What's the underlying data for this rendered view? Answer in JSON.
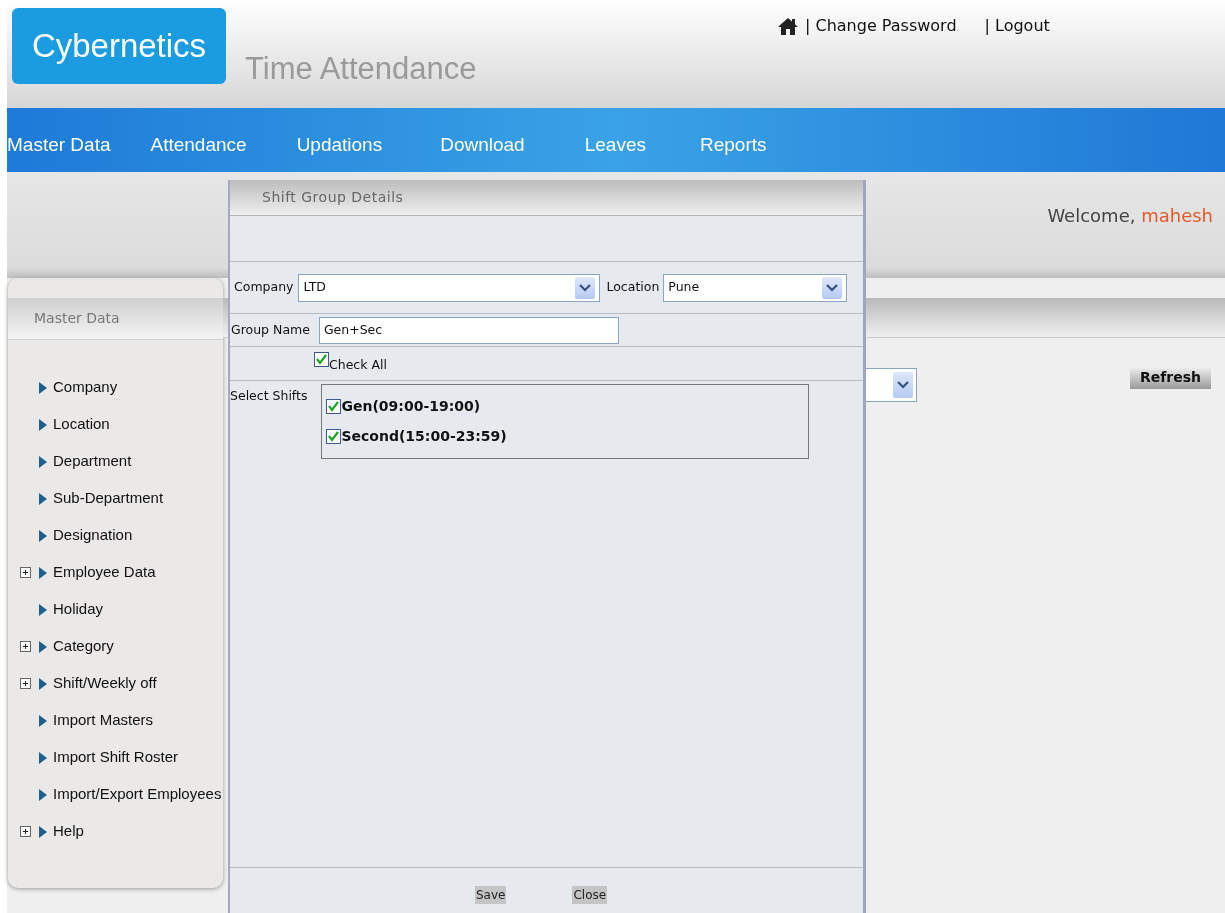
{
  "header": {
    "logo": "Cybernetics",
    "app_title": "Time Attendance",
    "links": [
      "| Change Password",
      "| Logout"
    ]
  },
  "nav": [
    "Master Data",
    "Attendance",
    "Updations",
    "Download",
    "Leaves",
    "Reports"
  ],
  "welcome": {
    "greeting": "Welcome,",
    "user": "mahesh"
  },
  "sidebar": {
    "title": "Master Data",
    "items": [
      {
        "label": "Company",
        "expandable": false
      },
      {
        "label": "Location",
        "expandable": false
      },
      {
        "label": "Department",
        "expandable": false
      },
      {
        "label": "Sub-Department",
        "expandable": false
      },
      {
        "label": "Designation",
        "expandable": false
      },
      {
        "label": "Employee Data",
        "expandable": true
      },
      {
        "label": "Holiday",
        "expandable": false
      },
      {
        "label": "Category",
        "expandable": true
      },
      {
        "label": "Shift/Weekly off",
        "expandable": true
      },
      {
        "label": "Import Masters",
        "expandable": false
      },
      {
        "label": "Import Shift Roster",
        "expandable": false
      },
      {
        "label": "Import/Export Employees",
        "expandable": false
      },
      {
        "label": "Help",
        "expandable": true
      }
    ]
  },
  "main": {
    "refresh_button": "Refresh"
  },
  "dialog": {
    "title": "Shift Group Details",
    "company": {
      "label": "Company",
      "value": "LTD"
    },
    "location": {
      "label": "Location",
      "value": "Pune"
    },
    "group_name": {
      "label": "Group Name",
      "value": "Gen+Sec"
    },
    "check_all": {
      "label": "Check All",
      "checked": true
    },
    "select_shifts": {
      "label": "Select Shifts",
      "shifts": [
        {
          "label": "Gen(09:00-19:00)",
          "checked": true
        },
        {
          "label": "Second(15:00-23:59)",
          "checked": true
        }
      ]
    },
    "buttons": [
      "Save",
      "Close"
    ]
  }
}
